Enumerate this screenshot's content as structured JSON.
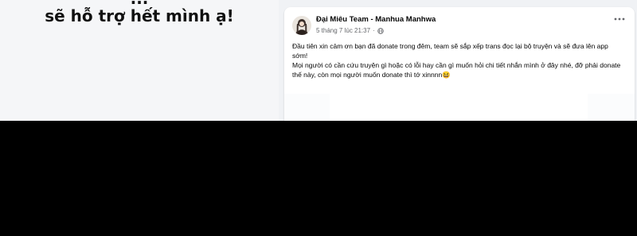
{
  "left": {
    "partial_line": "...",
    "caption": "sẽ hỗ trợ hết mình ạ!"
  },
  "post": {
    "author": "Đại Miêu Team - Manhua Manhwa",
    "timestamp": "5 tháng 7 lúc 21:37",
    "separator": "·",
    "more_icon": "more-dots-icon",
    "privacy_icon": "globe-icon",
    "paragraphs": [
      "Đầu tiên xin cảm ơn bạn đã donate trong đêm, team sẽ sắp xếp trans đọc lại bộ truyện và sẽ đưa lên app sớm!",
      "Mọi người có cần cứu truyện gì hoặc có lỗi hay cần gì muốn hỏi chi tiết nhắn mình ở đây nhé, đỡ phải donate thế này, còn mọi người muốn donate thì tớ xinnnn😆"
    ]
  }
}
